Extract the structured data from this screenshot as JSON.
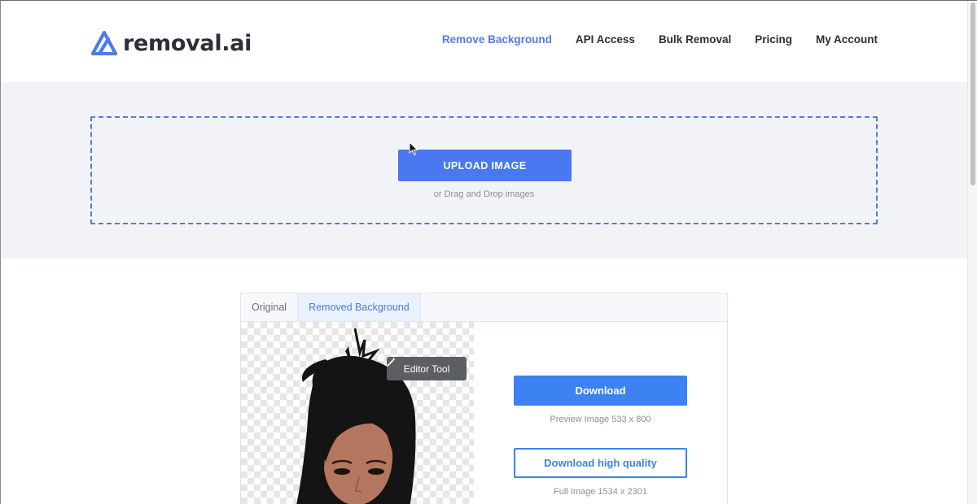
{
  "brand": {
    "name": "removal.ai",
    "accent_color": "#4f7be8"
  },
  "nav": {
    "items": [
      {
        "label": "Remove Background",
        "active": true
      },
      {
        "label": "API Access",
        "active": false
      },
      {
        "label": "Bulk Removal",
        "active": false
      },
      {
        "label": "Pricing",
        "active": false
      },
      {
        "label": "My Account",
        "active": false
      }
    ]
  },
  "upload": {
    "button_label": "UPLOAD IMAGE",
    "hint": "or Drag and Drop images"
  },
  "result": {
    "tabs": [
      {
        "label": "Original",
        "active": false
      },
      {
        "label": "Removed Background",
        "active": true
      }
    ],
    "editor_tool_label": "Editor Tool",
    "download_label": "Download",
    "preview_info": "Preview Image   533 x 800",
    "download_hq_label": "Download high quality",
    "full_info": "Full Image   1534 x 2301"
  },
  "icons": {
    "logo": "removal-logo-icon",
    "editor": "magic-wand-icon",
    "cursor": "mouse-cursor-icon"
  }
}
